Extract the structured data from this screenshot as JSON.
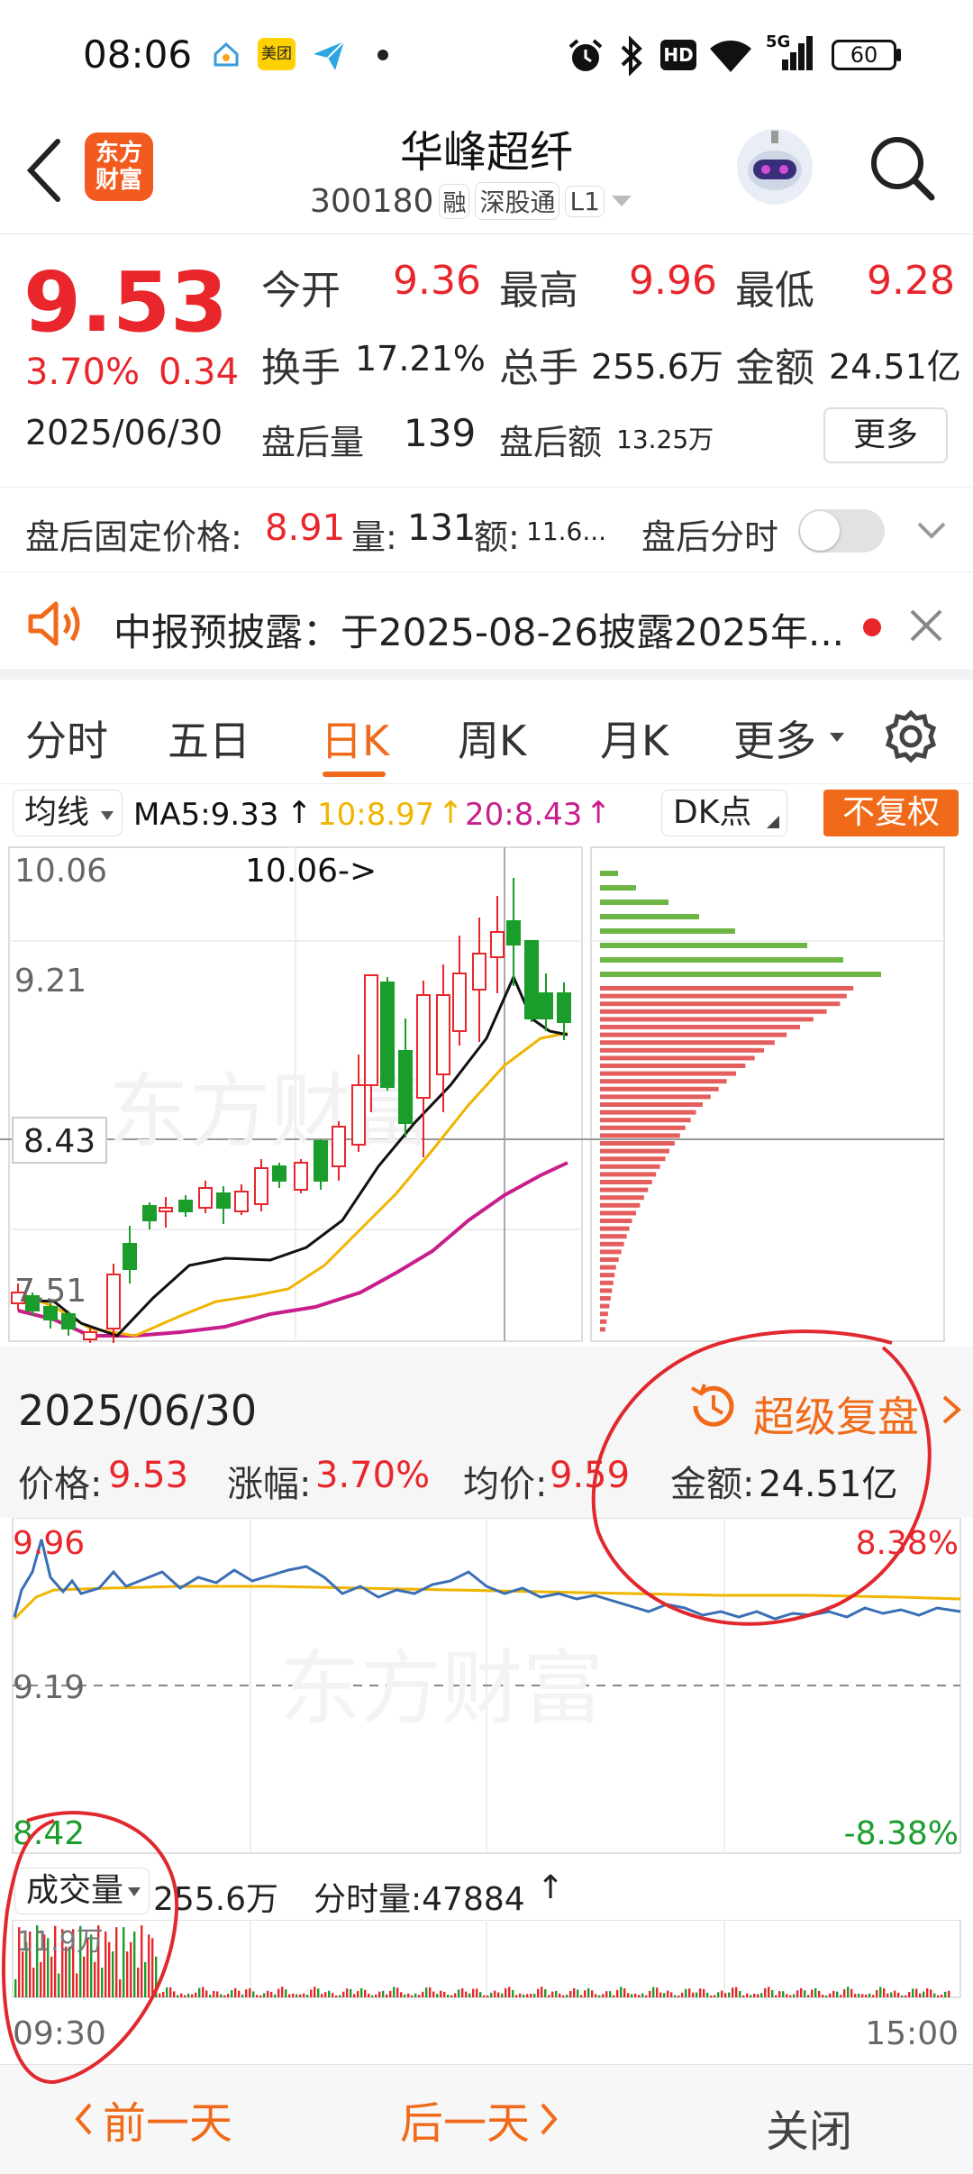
{
  "status_bar": {
    "time": "08:06",
    "icons": [
      "home-app-icon",
      "meituan-app-icon",
      "send-app-icon",
      "dot-icon",
      "alarm-icon",
      "bluetooth-icon",
      "hd-icon",
      "wifi-icon",
      "5g-signal-icon"
    ],
    "meituan_label": "美团",
    "hd_label": "HD",
    "net_label": "5G",
    "battery": "60"
  },
  "header": {
    "logo_line1": "东方",
    "logo_line2": "财富",
    "stock_name": "华峰超纤",
    "stock_code": "300180",
    "tags": [
      "融",
      "深股通",
      "L1"
    ]
  },
  "quote": {
    "price": "9.53",
    "change_pct": "3.70%",
    "change_amt": "0.34",
    "date": "2025/06/30",
    "open_label": "今开",
    "open": "9.36",
    "high_label": "最高",
    "high": "9.96",
    "low_label": "最低",
    "low": "9.28",
    "turnover_label": "换手",
    "turnover": "17.21%",
    "volume_label": "总手",
    "volume": "255.6万",
    "amount_label": "金额",
    "amount": "24.51亿",
    "after_vol_label": "盘后量",
    "after_vol": "139",
    "after_amt_label": "盘后额",
    "after_amt": "13.25万",
    "more_label": "更多"
  },
  "after_hours": {
    "fixed_price_label": "盘后固定价格:",
    "fixed_price": "8.91",
    "qty_label": "量:",
    "qty": "131",
    "amt_label": "额:",
    "amt": "11.6...",
    "toggle_label": "盘后分时"
  },
  "notice": {
    "text": "中报预披露：于2025-08-26披露2025年..."
  },
  "tabs": {
    "items": [
      "分时",
      "五日",
      "日K",
      "周K",
      "月K",
      "更多"
    ],
    "active_index": 2
  },
  "ma_bar": {
    "selector": "均线",
    "ma5": "MA5:9.33",
    "ma10": "10:8.97",
    "ma20": "20:8.43",
    "dk_label": "DK点",
    "fq_label": "不复权"
  },
  "kchart": {
    "price_labels": [
      "10.06",
      "9.21",
      "8.43",
      "7.51"
    ],
    "max_marker": "10.06->",
    "watermark": "东方财富"
  },
  "detail": {
    "date": "2025/06/30",
    "replay_label": "超级复盘",
    "price_label": "价格:",
    "price": "9.53",
    "chg_label": "涨幅:",
    "chg": "3.70%",
    "avg_label": "均价:",
    "avg": "9.59",
    "amt_label": "金额:",
    "amt": "24.51亿"
  },
  "intraday": {
    "high": "9.96",
    "mid": "9.19",
    "low": "8.42",
    "pct_high": "8.38%",
    "pct_low": "-8.38%",
    "watermark": "东方财富"
  },
  "volume": {
    "selector": "成交量",
    "total": "255.6万",
    "last_label": "分时量:47884",
    "max_label": "11.9万",
    "time_start": "09:30",
    "time_end": "15:00"
  },
  "bottom_bar": {
    "prev": "前一天",
    "next": "后一天",
    "close": "关闭"
  },
  "colors": {
    "up": "#e8262b",
    "down": "#1a9d2b",
    "accent": "#f06a1a",
    "ma5": "#111111",
    "ma10": "#f0b400",
    "ma20": "#c81e8c"
  }
}
